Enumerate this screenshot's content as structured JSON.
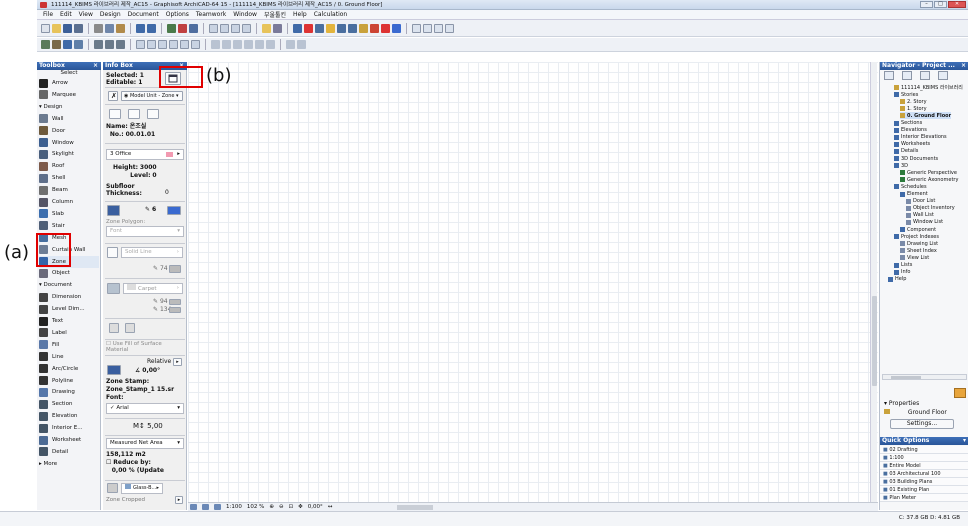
{
  "window": {
    "title": "111114_KBIMS 라이브러리 제작_AC15 - Graphisoft ArchiCAD-64 15 - [111114_KBIMS 라이브러리 제작_AC15 / 0. Ground Floor]",
    "minimize": "–",
    "maximize": "□",
    "close": "✕"
  },
  "menu": [
    "File",
    "Edit",
    "View",
    "Design",
    "Document",
    "Options",
    "Teamwork",
    "Window",
    "부울툴킨",
    "Help",
    "Calculation"
  ],
  "toolbox": {
    "title": "Toolbox",
    "close": "×",
    "select_label": "Select",
    "items": [
      {
        "label": "Arrow",
        "icon": "arrow-icon",
        "color": "#222222"
      },
      {
        "label": "Marquee",
        "icon": "marquee-icon",
        "color": "#666666"
      },
      {
        "label": "▾ Design",
        "icon": "",
        "color": ""
      },
      {
        "label": "Wall",
        "icon": "wall-icon",
        "color": "#6b7a8f"
      },
      {
        "label": "Door",
        "icon": "door-icon",
        "color": "#6e5a3c"
      },
      {
        "label": "Window",
        "icon": "window-icon",
        "color": "#3d5f8f"
      },
      {
        "label": "Skylight",
        "icon": "skylight-icon",
        "color": "#4a5f7d"
      },
      {
        "label": "Roof",
        "icon": "roof-icon",
        "color": "#7d5a4a"
      },
      {
        "label": "Shell",
        "icon": "shell-icon",
        "color": "#5f6f8a"
      },
      {
        "label": "Beam",
        "icon": "beam-icon",
        "color": "#6f6f6f"
      },
      {
        "label": "Column",
        "icon": "column-icon",
        "color": "#555566"
      },
      {
        "label": "Slab",
        "icon": "slab-icon",
        "color": "#3c6eae"
      },
      {
        "label": "Stair",
        "icon": "stair-icon",
        "color": "#4f5f77"
      },
      {
        "label": "Mesh",
        "icon": "mesh-icon",
        "color": "#476f9f"
      },
      {
        "label": "Curtain Wall",
        "icon": "curtain-wall-icon",
        "color": "#6d7d95"
      },
      {
        "label": "Zone",
        "icon": "zone-icon",
        "color": "#3464a8"
      },
      {
        "label": "Object",
        "icon": "object-icon",
        "color": "#6a6a7a"
      },
      {
        "label": "▾ Document",
        "icon": "",
        "color": ""
      },
      {
        "label": "Dimension",
        "icon": "dimension-icon",
        "color": "#444444"
      },
      {
        "label": "Level Dim...",
        "icon": "level-dimension-icon",
        "color": "#444444"
      },
      {
        "label": "Text",
        "icon": "text-icon",
        "color": "#222222"
      },
      {
        "label": "Label",
        "icon": "label-icon",
        "color": "#444444"
      },
      {
        "label": "Fill",
        "icon": "fill-icon",
        "color": "#5a78a8"
      },
      {
        "label": "Line",
        "icon": "line-icon",
        "color": "#333333"
      },
      {
        "label": "Arc/Circle",
        "icon": "arc-circle-icon",
        "color": "#333333"
      },
      {
        "label": "Polyline",
        "icon": "polyline-icon",
        "color": "#333333"
      },
      {
        "label": "Drawing",
        "icon": "drawing-icon",
        "color": "#5577aa"
      },
      {
        "label": "Section",
        "icon": "section-icon",
        "color": "#445566"
      },
      {
        "label": "Elevation",
        "icon": "elevation-icon",
        "color": "#445566"
      },
      {
        "label": "Interior E...",
        "icon": "interior-elevation-icon",
        "color": "#445566"
      },
      {
        "label": "Worksheet",
        "icon": "worksheet-icon",
        "color": "#4c6a94"
      },
      {
        "label": "Detail",
        "icon": "detail-icon",
        "color": "#445566"
      },
      {
        "label": "▸ More",
        "icon": "",
        "color": ""
      }
    ]
  },
  "infobox": {
    "title": "Info Box",
    "close": "×",
    "selected": "Selected: 1",
    "editable": "Editable: 1",
    "model_unit": "Model Unit - Zone",
    "name_label": "Name:",
    "name_value": "온조실",
    "no_label": "No.:",
    "no_value": "00.01.01",
    "category": "3 Office",
    "height_label": "Height:",
    "height_value": "3000",
    "level_label": "Level:",
    "level_value": "0",
    "subfloor_label": "Subfloor Thickness:",
    "subfloor_value": "0",
    "pen_value": "6",
    "zone_polygon": "Zone Polygon:",
    "font_placeholder": "Font",
    "solid_line": "Solid Line",
    "val_74": "74",
    "carpet": "Carpet",
    "val_94": "94",
    "val_134": "134",
    "use_fill": "Use Fill of Surface Material",
    "relative": "Relative",
    "angle": "0,00°",
    "zone_stamp_label": "Zone Stamp:",
    "zone_stamp_value": "Zone_Stamp_1 15.sr",
    "font_label": "Font:",
    "font_value": "Arial",
    "font_size": "5,00",
    "measured_area": "Measured Net Area",
    "area_value": "158,112 m2",
    "reduce_by": "Reduce by:",
    "reduce_value": "0,00 % (Update",
    "glass": "Glass-B...",
    "zone_cropped": "Zone Cropped"
  },
  "statusbar": {
    "zoom_scale": "1:100",
    "zoom_percent": "102 %",
    "angle": "0,00°"
  },
  "navigator": {
    "title": "Navigator - Project ...",
    "close": "×",
    "tree": [
      {
        "label": "111114_KBIMS 라이브러리",
        "icon": "project-icon",
        "color": "#c9a23c"
      },
      {
        "label": "Stories",
        "icon": "stories-icon",
        "color": "#3f6aa8"
      },
      {
        "label": "2. Story",
        "icon": "story-icon",
        "color": "#c9a23c"
      },
      {
        "label": "1. Story",
        "icon": "story-icon",
        "color": "#c9a23c"
      },
      {
        "label": "0. Ground Floor",
        "icon": "story-icon",
        "color": "#c9a23c"
      },
      {
        "label": "Sections",
        "icon": "sections-icon",
        "color": "#3f6aa8"
      },
      {
        "label": "Elevations",
        "icon": "elevations-icon",
        "color": "#3f6aa8"
      },
      {
        "label": "Interior Elevations",
        "icon": "interior-elevations-icon",
        "color": "#3f6aa8"
      },
      {
        "label": "Worksheets",
        "icon": "worksheets-icon",
        "color": "#3f6aa8"
      },
      {
        "label": "Details",
        "icon": "details-icon",
        "color": "#3f6aa8"
      },
      {
        "label": "3D Documents",
        "icon": "3d-documents-icon",
        "color": "#3f6aa8"
      },
      {
        "label": "3D",
        "icon": "3d-icon",
        "color": "#3f6aa8"
      },
      {
        "label": "Generic Perspective",
        "icon": "perspective-icon",
        "color": "#2c7a3c"
      },
      {
        "label": "Generic Axonometry",
        "icon": "axonometry-icon",
        "color": "#2c7a3c"
      },
      {
        "label": "Schedules",
        "icon": "schedules-icon",
        "color": "#3f6aa8"
      },
      {
        "label": "Element",
        "icon": "element-icon",
        "color": "#3f6aa8"
      },
      {
        "label": "Door List",
        "icon": "list-icon",
        "color": "#7a8aa8"
      },
      {
        "label": "Object Inventory",
        "icon": "list-icon",
        "color": "#7a8aa8"
      },
      {
        "label": "Wall List",
        "icon": "list-icon",
        "color": "#7a8aa8"
      },
      {
        "label": "Window List",
        "icon": "list-icon",
        "color": "#7a8aa8"
      },
      {
        "label": "Component",
        "icon": "component-icon",
        "color": "#3f6aa8"
      },
      {
        "label": "Project Indexes",
        "icon": "indexes-icon",
        "color": "#3f6aa8"
      },
      {
        "label": "Drawing List",
        "icon": "list-icon",
        "color": "#7a8aa8"
      },
      {
        "label": "Sheet Index",
        "icon": "list-icon",
        "color": "#7a8aa8"
      },
      {
        "label": "View List",
        "icon": "list-icon",
        "color": "#7a8aa8"
      },
      {
        "label": "Lists",
        "icon": "lists-icon",
        "color": "#3f6aa8"
      },
      {
        "label": "Info",
        "icon": "info-icon",
        "color": "#3f6aa8"
      },
      {
        "label": "Help",
        "icon": "help-icon",
        "color": "#3f6aa8"
      }
    ],
    "properties_label": "▾ Properties",
    "prop_floor": "Ground Floor",
    "settings": "Settings...",
    "quick_options": "Quick Options",
    "qo_items": [
      "02 Drafting",
      "1:100",
      "Entire Model",
      "03 Architectural 100",
      "03 Building Plans",
      "01 Existing Plan",
      "Plan Meter"
    ]
  },
  "coords": "C: 37.8 GB   D: 4.81 GB",
  "annotations": {
    "a": "(a)",
    "b": "(b)"
  }
}
